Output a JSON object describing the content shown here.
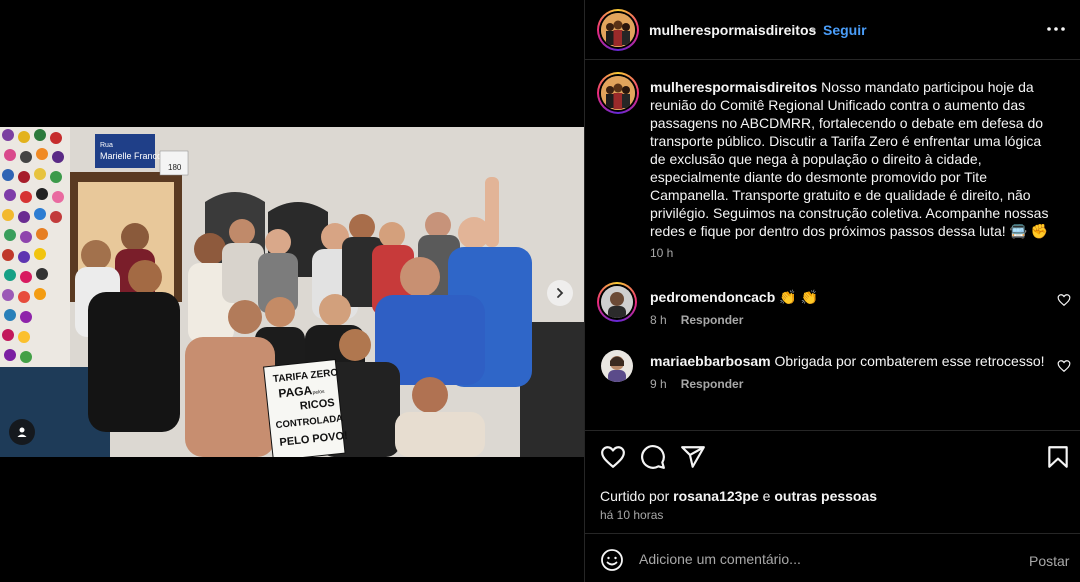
{
  "post": {
    "author": "mulherespormaisdireitos",
    "follow_label": "Seguir",
    "dot": "•",
    "caption": "Nosso mandato participou hoje da reunião do Comitê Regional Unificado contra o aumento das passagens no ABCDMRR, fortalecendo o debate em defesa do transporte público. Discutir a Tarifa Zero é enfrentar uma lógica de exclusão que nega à população o direito à cidade, especialmente diante do desmonte promovido por Tite Campanella. Transporte gratuito e de qualidade é direito, não privilégio. Seguimos na construção coletiva. Acompanhe nossas redes e fique por dentro dos próximos passos dessa luta! 🚍 ✊",
    "caption_time": "10 h"
  },
  "photo": {
    "sign_plate": "Rua Marielle Franco",
    "door_number": "180",
    "protest_sign": [
      "TARIFA ZERO",
      "PAGA",
      "pelos",
      "RICOS",
      "CONTROLADA",
      "PELO POVO!"
    ]
  },
  "comments": [
    {
      "user": "pedromendoncacb",
      "text": "👏 👏",
      "time": "8 h",
      "reply_label": "Responder"
    },
    {
      "user": "mariaebbarbosam",
      "text": "Obrigada por combaterem esse retrocesso!",
      "time": "9 h",
      "reply_label": "Responder"
    }
  ],
  "likes": {
    "prefix": "Curtido por",
    "user": "rosana123pe",
    "connector": "e",
    "others": "outras pessoas"
  },
  "post_time": "há 10 horas",
  "comment_box": {
    "placeholder": "Adicione um comentário...",
    "post_label": "Postar"
  }
}
